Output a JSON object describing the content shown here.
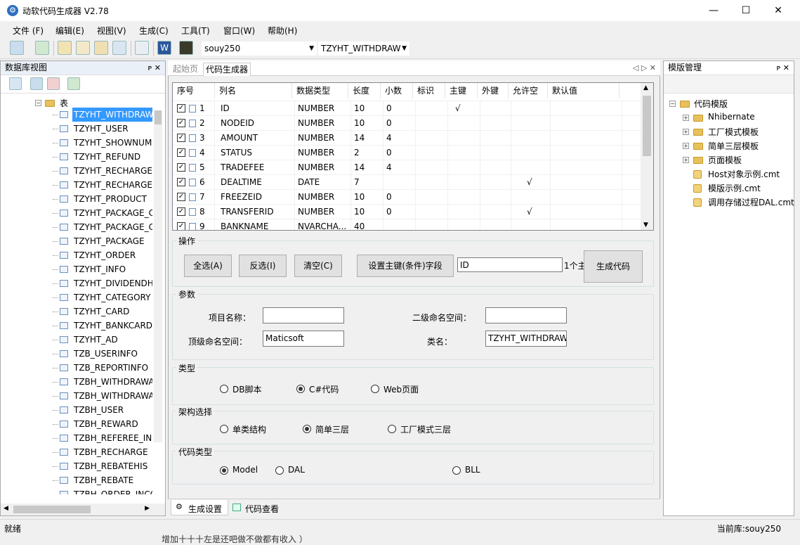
{
  "window": {
    "title": "动软代码生成器  V2.78",
    "min": "—",
    "max": "☐",
    "close": "✕"
  },
  "menu": [
    "文件 (F)",
    "编辑(E)",
    "视图(V)",
    "生成(C)",
    "工具(T)",
    "窗口(W)",
    "帮助(H)"
  ],
  "toolbar": {
    "db_combo": "souy250",
    "table_combo": "TZYHT_WITHDRAW"
  },
  "left_panel": {
    "title": "数据库视图",
    "pin": "ᴘ ✕",
    "node": "表",
    "tables": [
      "TZYHT_WITHDRAW",
      "TZYHT_USER",
      "TZYHT_SHOWNUM",
      "TZYHT_REFUND",
      "TZYHT_RECHARGE_",
      "TZYHT_RECHARGE",
      "TZYHT_PRODUCT",
      "TZYHT_PACKAGE_C",
      "TZYHT_PACKAGE_C",
      "TZYHT_PACKAGE",
      "TZYHT_ORDER",
      "TZYHT_INFO",
      "TZYHT_DIVIDENDH",
      "TZYHT_CATEGORY",
      "TZYHT_CARD",
      "TZYHT_BANKCARD",
      "TZYHT_AD",
      "TZB_USERINFO",
      "TZB_REPORTINFO",
      "TZBH_WITHDRAWA",
      "TZBH_WITHDRAWA",
      "TZBH_USER",
      "TZBH_REWARD",
      "TZBH_REFEREE_INC",
      "TZBH_RECHARGE",
      "TZBH_REBATEHIS",
      "TZBH_REBATE",
      "TZBH_ORDER_INCC"
    ]
  },
  "center": {
    "tabs": [
      "起始页",
      "代码生成器"
    ],
    "tab_nav": "◁ ▷ ✕",
    "grid": {
      "headers": [
        "序号",
        "列名",
        "数据类型",
        "长度",
        "小数",
        "标识",
        "主键",
        "外键",
        "允许空",
        "默认值"
      ],
      "rows": [
        {
          "n": "1",
          "name": "ID",
          "type": "NUMBER",
          "len": "10",
          "dec": "0",
          "pk": "√",
          "nullable": ""
        },
        {
          "n": "2",
          "name": "NODEID",
          "type": "NUMBER",
          "len": "10",
          "dec": "0",
          "pk": "",
          "nullable": ""
        },
        {
          "n": "3",
          "name": "AMOUNT",
          "type": "NUMBER",
          "len": "14",
          "dec": "4",
          "pk": "",
          "nullable": ""
        },
        {
          "n": "4",
          "name": "STATUS",
          "type": "NUMBER",
          "len": "2",
          "dec": "0",
          "pk": "",
          "nullable": ""
        },
        {
          "n": "5",
          "name": "TRADEFEE",
          "type": "NUMBER",
          "len": "14",
          "dec": "4",
          "pk": "",
          "nullable": ""
        },
        {
          "n": "6",
          "name": "DEALTIME",
          "type": "DATE",
          "len": "7",
          "dec": "",
          "pk": "",
          "nullable": "√"
        },
        {
          "n": "7",
          "name": "FREEZEID",
          "type": "NUMBER",
          "len": "10",
          "dec": "0",
          "pk": "",
          "nullable": ""
        },
        {
          "n": "8",
          "name": "TRANSFERID",
          "type": "NUMBER",
          "len": "10",
          "dec": "0",
          "pk": "",
          "nullable": "√"
        },
        {
          "n": "9",
          "name": "BANKNAME",
          "type": "NVARCHA...",
          "len": "40",
          "dec": "",
          "pk": "",
          "nullable": ""
        }
      ],
      "check": "✓"
    },
    "ops": {
      "label": "操作",
      "select_all": "全选(A)",
      "invert": "反选(I)",
      "clear": "清空(C)",
      "set_pk": "设置主键(条件)字段",
      "pk_value": "ID",
      "pk_count": "1个主",
      "generate": "生成代码"
    },
    "params": {
      "label": "参数",
      "project_name_label": "项目名称：",
      "project_name": "",
      "sub_ns_label": "二级命名空间：",
      "sub_ns": "",
      "top_ns_label": "顶级命名空间：",
      "top_ns": "Maticsoft",
      "class_label": "类名：",
      "class_name": "TZYHT_WITHDRAW"
    },
    "type": {
      "label": "类型",
      "options": [
        "DB脚本",
        "C#代码",
        "Web页面"
      ],
      "selected": 1
    },
    "arch": {
      "label": "架构选择",
      "options": [
        "单类结构",
        "简单三层",
        "工厂模式三层"
      ],
      "selected": 1
    },
    "codetype": {
      "label": "代码类型",
      "options": [
        "Model",
        "DAL",
        "BLL"
      ],
      "selected": 0
    },
    "bottom_tabs": [
      "生成设置",
      "代码查看"
    ]
  },
  "right_panel": {
    "title": "模版管理",
    "pin": "ᴘ ✕",
    "root": "代码模版",
    "folders": [
      "Nhibernate",
      "工厂模式模板",
      "简单三层模板",
      "页面模板"
    ],
    "files": [
      "Host对象示例.cmt",
      "模版示例.cmt",
      "调用存储过程DAL.cmt"
    ]
  },
  "status": {
    "left": "就绪",
    "right": "当前库:souy250",
    "overflow_text": "增加十十十左是还吧做不做都有收入 ）"
  }
}
